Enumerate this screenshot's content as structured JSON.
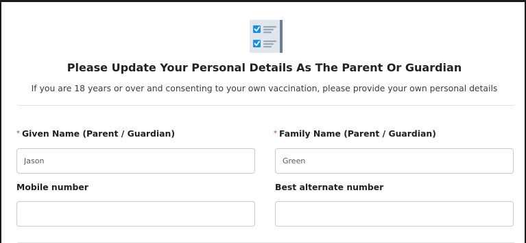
{
  "header": {
    "icon": "checklist-icon",
    "title": "Please Update Your Personal Details As The Parent Or Guardian",
    "subtitle": "If you are 18 years or over and consenting to your own vaccination, please provide your own personal details"
  },
  "form": {
    "required_marker": "*",
    "given_name": {
      "label": "Given Name (Parent / Guardian)",
      "value": "Jason",
      "required": true
    },
    "family_name": {
      "label": "Family Name (Parent / Guardian)",
      "value": "Green",
      "required": true
    },
    "mobile_number": {
      "label": "Mobile number",
      "value": ""
    },
    "alternate_number": {
      "label": "Best alternate number",
      "value": ""
    }
  },
  "colors": {
    "required_marker": "#c23934",
    "icon_checkbox": "#1b8fd9",
    "icon_panel": "#dfe6ee"
  }
}
